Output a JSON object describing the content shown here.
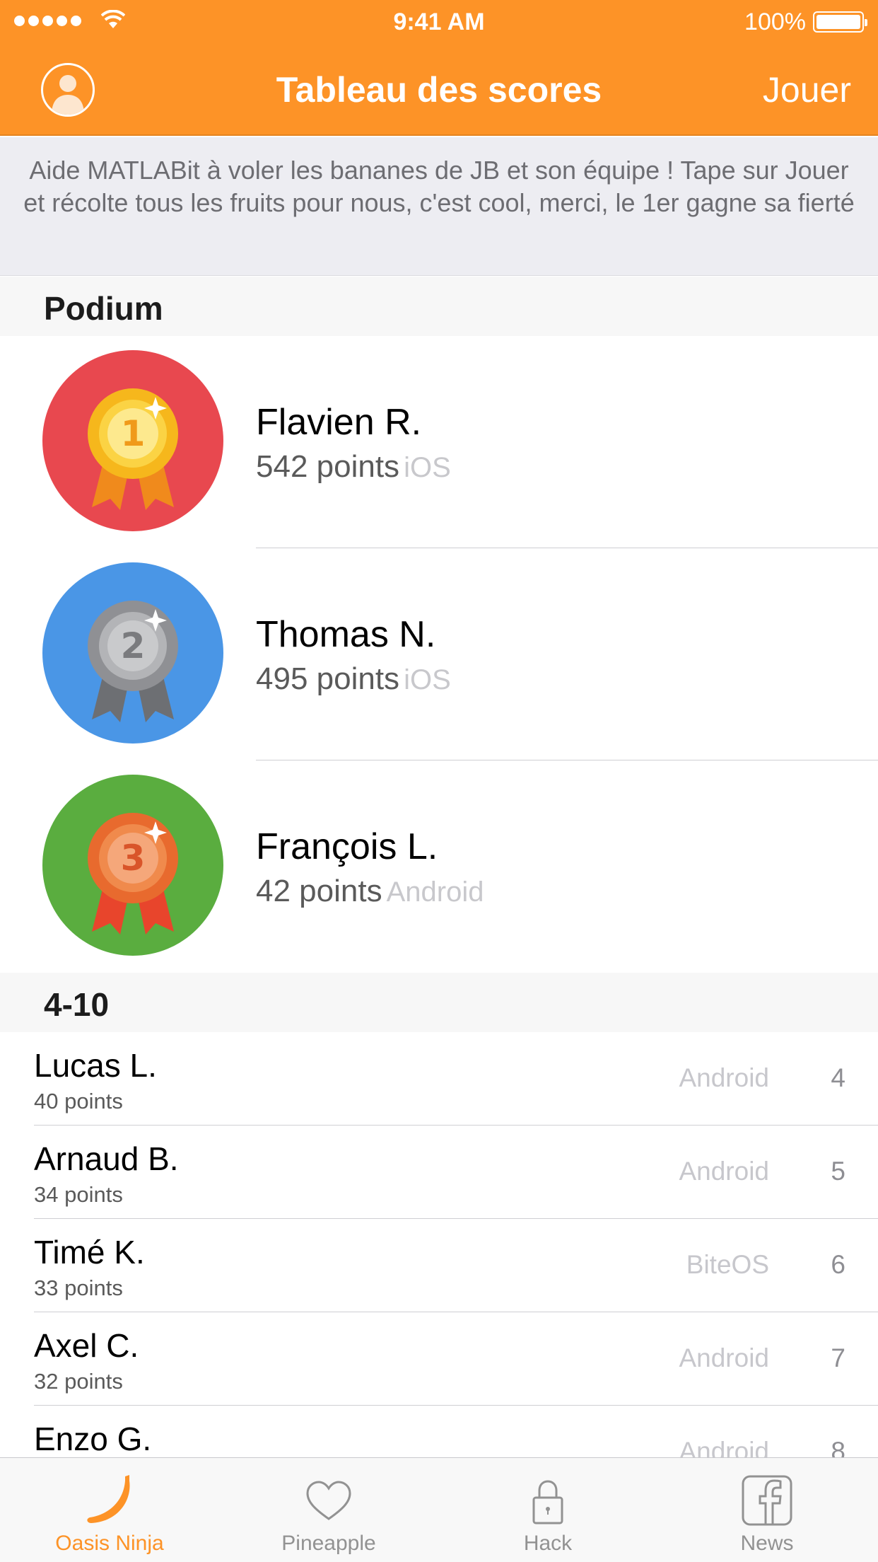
{
  "status_bar": {
    "time": "9:41 AM",
    "battery": "100%"
  },
  "nav": {
    "title": "Tableau des scores",
    "action": "Jouer",
    "left_icon": "user-avatar-icon"
  },
  "banner": {
    "text": "Aide MATLABit à voler les bananes de JB et son équipe ! Tape sur Jouer et récolte tous les fruits pour nous, c'est cool, merci, le 1er gagne sa fierté"
  },
  "podium": {
    "header": "Podium",
    "entries": [
      {
        "name": "Flavien R.",
        "points": "542 points",
        "platform": "iOS",
        "medal": "1",
        "badge_color": "#e8484f",
        "icon": "gold-medal-icon"
      },
      {
        "name": "Thomas N.",
        "points": "495 points",
        "platform": "iOS",
        "medal": "2",
        "badge_color": "#4a96e6",
        "icon": "silver-medal-icon"
      },
      {
        "name": "François L.",
        "points": "42 points",
        "platform": "Android",
        "medal": "3",
        "badge_color": "#5aad3f",
        "icon": "bronze-medal-icon"
      }
    ]
  },
  "ranking": {
    "header": "4-10",
    "rows": [
      {
        "name": "Lucas L.",
        "points": "40 points",
        "platform": "Android",
        "rank": "4"
      },
      {
        "name": "Arnaud B.",
        "points": "34 points",
        "platform": "Android",
        "rank": "5"
      },
      {
        "name": "Timé K.",
        "points": "33 points",
        "platform": "BiteOS",
        "rank": "6"
      },
      {
        "name": "Axel C.",
        "points": "32 points",
        "platform": "Android",
        "rank": "7"
      },
      {
        "name": "Enzo G.",
        "points": "",
        "platform": "Android",
        "rank": "8"
      }
    ]
  },
  "tabs": [
    {
      "label": "Oasis Ninja",
      "icon": "banana-icon",
      "active": true
    },
    {
      "label": "Pineapple",
      "icon": "heart-icon",
      "active": false
    },
    {
      "label": "Hack",
      "icon": "lock-icon",
      "active": false
    },
    {
      "label": "News",
      "icon": "facebook-icon",
      "active": false
    }
  ],
  "colors": {
    "accent": "#fd9327",
    "banner_bg": "#ededf2",
    "inactive_tab": "#929292"
  }
}
